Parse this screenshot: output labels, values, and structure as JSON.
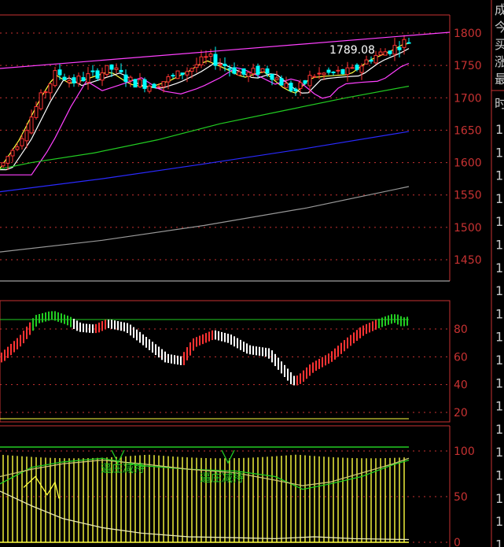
{
  "main_chart": {
    "last_price_label": "1789.08",
    "y_ticks": [
      "1800",
      "1750",
      "1700",
      "1650",
      "1600",
      "1550",
      "1500",
      "1450"
    ]
  },
  "indicator1": {
    "y_ticks": [
      "80",
      "60",
      "40",
      "20"
    ]
  },
  "indicator2": {
    "y_ticks": [
      "100",
      "50",
      "0"
    ],
    "labels": [
      "逼庄减持",
      "逼庄减持"
    ]
  },
  "side_panel": {
    "top_chars": [
      "成",
      "今",
      "买",
      "涨",
      "最"
    ],
    "header_char": "时",
    "row_char": "1",
    "row_count": 19
  },
  "chart_data": [
    {
      "type": "candlestick",
      "y_ticks": [
        1800,
        1750,
        1700,
        1650,
        1600,
        1550,
        1500,
        1450
      ],
      "annotations": [
        "1789.08"
      ]
    },
    {
      "type": "bar",
      "y_ticks": [
        80,
        60,
        40,
        20
      ]
    },
    {
      "type": "bar",
      "y_ticks": [
        100,
        50,
        0
      ],
      "annotations": [
        "逼庄减持",
        "逼庄减持"
      ]
    }
  ],
  "colors": {
    "frame": "#c83232",
    "up": "#ff3333",
    "down": "#00ffff",
    "ma_pink": "#ff40ff",
    "ma_yellow": "#ffff40",
    "ma_green": "#22cc22",
    "ma_blue": "#2a2aff",
    "ma_gray": "#999999"
  }
}
